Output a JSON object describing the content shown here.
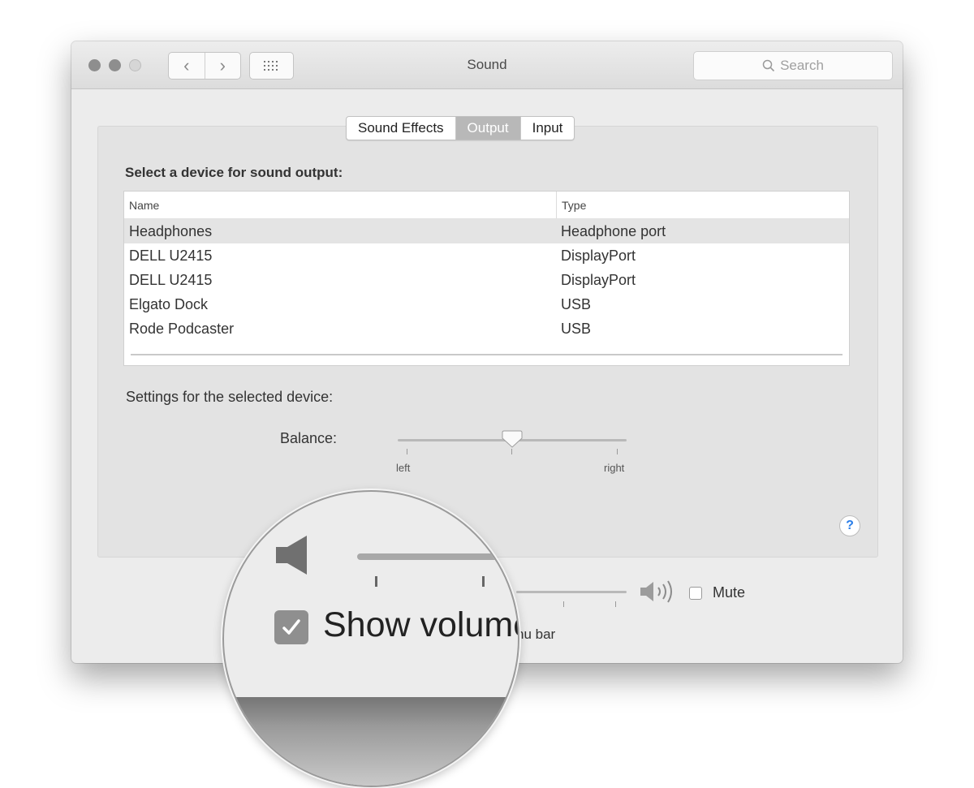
{
  "window": {
    "title": "Sound",
    "search_placeholder": "Search"
  },
  "tabs": [
    {
      "label": "Sound Effects",
      "active": false
    },
    {
      "label": "Output",
      "active": true
    },
    {
      "label": "Input",
      "active": false
    }
  ],
  "output": {
    "section_title": "Select a device for sound output:",
    "columns": [
      "Name",
      "Type"
    ],
    "devices": [
      {
        "name": "Headphones",
        "type": "Headphone port",
        "selected": true
      },
      {
        "name": "DELL U2415",
        "type": "DisplayPort",
        "selected": false
      },
      {
        "name": "DELL U2415",
        "type": "DisplayPort",
        "selected": false
      },
      {
        "name": "Elgato Dock",
        "type": "USB",
        "selected": false
      },
      {
        "name": "Rode Podcaster",
        "type": "USB",
        "selected": false
      }
    ]
  },
  "settings": {
    "label": "Settings for the selected device:",
    "balance_label": "Balance:",
    "balance_left": "left",
    "balance_right": "right",
    "balance_value": 0.5
  },
  "volume": {
    "mute_label": "Mute",
    "mute_checked": false,
    "menubar_text": "nu bar"
  },
  "magnifier": {
    "show_volume_text": "Show volume",
    "show_volume_checked": true
  },
  "help_label": "?",
  "colors": {
    "active_tab": "#b8b8b8",
    "help_accent": "#2a7ee8"
  }
}
